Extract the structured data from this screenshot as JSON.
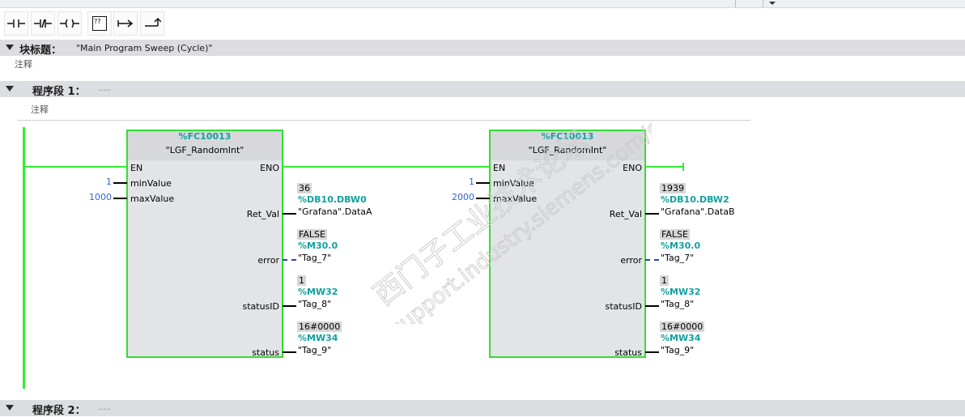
{
  "toolbar": {
    "buttons": [
      {
        "name": "no-contact-button",
        "icon": "normally-open-contact-icon"
      },
      {
        "name": "nc-contact-button",
        "icon": "normally-closed-contact-icon"
      },
      {
        "name": "coil-button",
        "icon": "coil-icon"
      },
      {
        "name": "empty-box-button",
        "icon": "empty-box-icon"
      },
      {
        "name": "open-branch-button",
        "icon": "open-branch-icon"
      },
      {
        "name": "close-branch-button",
        "icon": "close-branch-icon"
      }
    ],
    "empty_box_label": "??"
  },
  "block_title": {
    "label": "块标题：",
    "value": "\"Main Program Sweep (Cycle)\"",
    "comment": "注释"
  },
  "network1": {
    "label": "程序段 1：",
    "dots": ".....",
    "comment": "注释",
    "blocks": [
      {
        "number": "%FC10013",
        "name": "\"LGF_RandomInt\"",
        "in": {
          "en": "EN",
          "min": "minValue",
          "max": "maxValue"
        },
        "in_values": {
          "min": "1",
          "max": "1000"
        },
        "out": {
          "eno": "ENO",
          "ret": "Ret_Val",
          "error": "error",
          "statusid": "statusID",
          "status": "status"
        },
        "ret": {
          "monitor": "36",
          "address": "%DB10.DBW0",
          "symbol": "\"Grafana\".DataA"
        },
        "error": {
          "monitor": "FALSE",
          "address": "%M30.0",
          "symbol": "\"Tag_7\""
        },
        "statusid": {
          "monitor": "1",
          "address": "%MW32",
          "symbol": "\"Tag_8\""
        },
        "status": {
          "monitor": "16#0000",
          "address": "%MW34",
          "symbol": "\"Tag_9\""
        }
      },
      {
        "number": "%FC10013",
        "name": "\"LGF_RandomInt\"",
        "in": {
          "en": "EN",
          "min": "minValue",
          "max": "maxValue"
        },
        "in_values": {
          "min": "1",
          "max": "2000"
        },
        "out": {
          "eno": "ENO",
          "ret": "Ret_Val",
          "error": "error",
          "statusid": "statusID",
          "status": "status"
        },
        "ret": {
          "monitor": "1939",
          "address": "%DB10.DBW2",
          "symbol": "\"Grafana\".DataB"
        },
        "error": {
          "monitor": "FALSE",
          "address": "%M30.0",
          "symbol": "\"Tag_7\""
        },
        "statusid": {
          "monitor": "1",
          "address": "%MW32",
          "symbol": "\"Tag_8\""
        },
        "status": {
          "monitor": "16#0000",
          "address": "%MW34",
          "symbol": "\"Tag_9\""
        }
      }
    ]
  },
  "network2": {
    "label": "程序段 2：",
    "dots": "....."
  },
  "watermark": {
    "line1": "西门子工业技术论坛",
    "line2": "support.industry.siemens.com/cs"
  },
  "colors": {
    "powerflow": "#33ee33",
    "address": "#12a0a0",
    "const_value": "#3366cc",
    "section_bar": "#dcdde0"
  }
}
